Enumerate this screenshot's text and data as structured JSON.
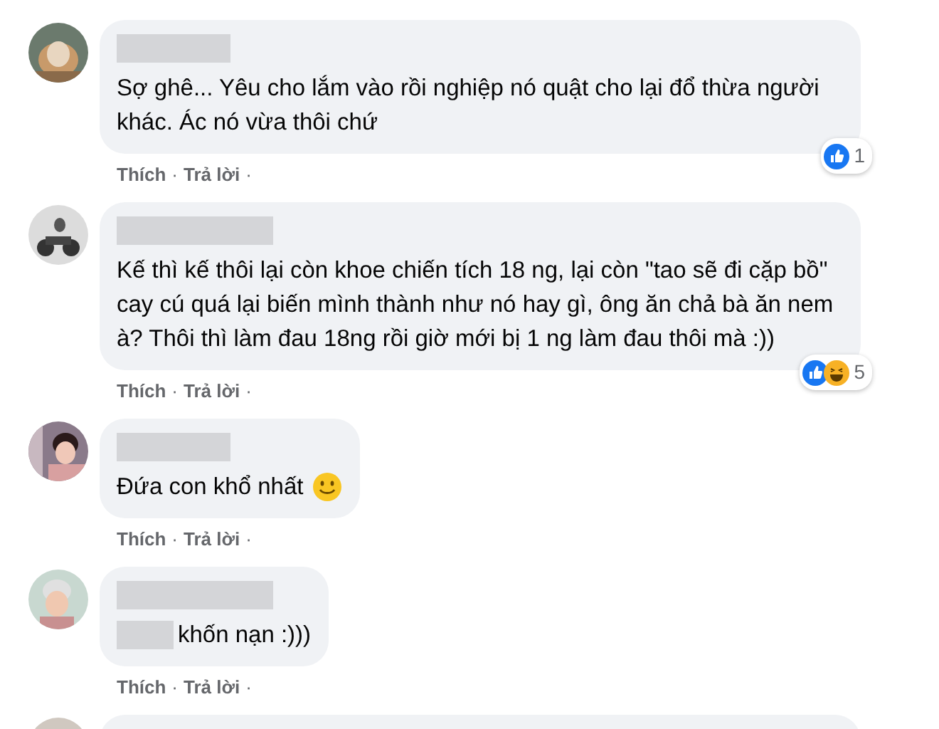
{
  "comments": [
    {
      "name_redacted": true,
      "text": "Sợ ghê... Yêu cho lắm vào rồi nghiệp nó quật cho lại đổ thừa người khác. Ác nó vừa thôi chứ",
      "actions": [
        {
          "kind": "link",
          "text": "Thích"
        },
        {
          "kind": "dot",
          "text": "·"
        },
        {
          "kind": "link",
          "text": "Trả lời"
        },
        {
          "kind": "dot",
          "text": "·"
        }
      ],
      "reactions": {
        "icons": [
          {
            "kind": "like"
          }
        ],
        "count": "1"
      }
    },
    {
      "name_redacted": true,
      "text": "Kế thì kế thôi lại còn khoe chiến tích 18 ng, lại còn \"tao sẽ đi cặp bồ\" cay cú quá lại biến mình thành như nó hay gì, ông ăn chả bà ăn nem à? Thôi thì làm đau 18ng rồi giờ mới bị 1 ng làm đau thôi mà :))",
      "actions": [
        {
          "kind": "link",
          "text": "Thích"
        },
        {
          "kind": "dot",
          "text": "·"
        },
        {
          "kind": "link",
          "text": "Trả lời"
        },
        {
          "kind": "dot",
          "text": "·"
        }
      ],
      "reactions": {
        "icons": [
          {
            "kind": "like"
          },
          {
            "kind": "haha"
          }
        ],
        "count": "5"
      }
    },
    {
      "name_redacted": true,
      "text": "Đứa con khổ nhất",
      "smiley": true,
      "actions": [
        {
          "kind": "link",
          "text": "Thích"
        },
        {
          "kind": "dot",
          "text": "·"
        },
        {
          "kind": "link",
          "text": "Trả lời"
        },
        {
          "kind": "dot",
          "text": "·"
        }
      ]
    },
    {
      "name_redacted": true,
      "text_redacted_start": true,
      "text": "khốn nạn :)))",
      "actions": [
        {
          "kind": "link",
          "text": "Thích"
        },
        {
          "kind": "dot",
          "text": "·"
        },
        {
          "kind": "link",
          "text": "Trả lời"
        },
        {
          "kind": "dot",
          "text": "·"
        }
      ]
    },
    {
      "cut_off": true
    }
  ]
}
